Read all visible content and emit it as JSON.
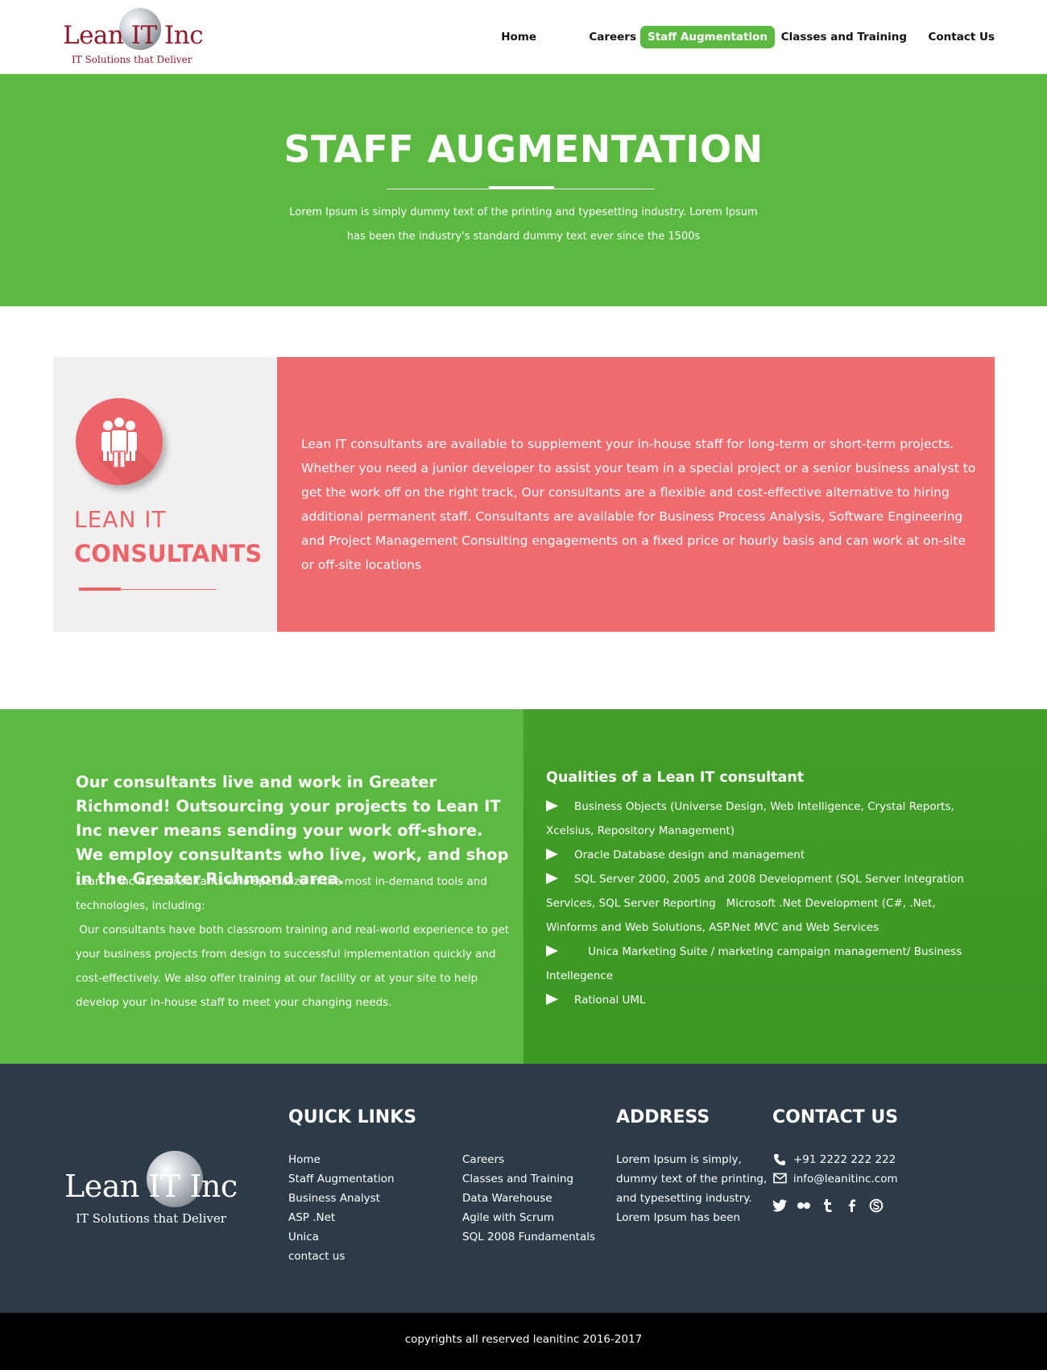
{
  "header": {
    "logo": {
      "brand": "Lean IT Inc",
      "tagline": "IT Solutions that Deliver"
    },
    "nav": [
      {
        "label": "Home",
        "active": false
      },
      {
        "label": "Careers",
        "active": false
      },
      {
        "label": "Staff Augmentation",
        "active": true
      },
      {
        "label": "Classes and Training",
        "active": false
      },
      {
        "label": "Contact Us",
        "active": false
      }
    ]
  },
  "hero": {
    "title": "STAFF AUGMENTATION",
    "subtitle": "Lorem Ipsum is simply dummy text of the printing and typesetting industry. Lorem Ipsum has been the industry's standard dummy text ever since the 1500s"
  },
  "consultants": {
    "icon": "team-icon",
    "heading_light": "LEAN IT",
    "heading_bold": "CONSULTANTS",
    "text": "Lean IT consultants are available to supplement your in-house staff for long-term or short-term projects. Whether you need a junior developer to assist your team in a special project or a senior business analyst to get the work off on the right track, Our consultants are a flexible and cost-effective alternative to hiring additional permanent staff. Consultants are available for Business Process Analysis, Software Engineering and Project Management Consulting engagements on a fixed price or hourly basis and can work at on-site or off-site locations"
  },
  "local": {
    "heading": "Our consultants live and work in Greater Richmond! Outsourcing your projects to Lean IT Inc never means sending your work off-shore. We employ consultants who live, work, and shop in the Greater Richmond area.",
    "body1": "Lean IT Inc has consultants who specialize in the most in-demand tools and technologies, including:",
    "body2": " Our consultants have both classroom training and real-world experience to get your business projects from design to successful implementation quickly and cost-effectively. We also offer training at our facility or at your site to help develop your in-house staff to meet your changing needs."
  },
  "qualities": {
    "title": "Qualities of a Lean IT consultant",
    "items": [
      "Business Objects (Universe Design, Web Intelligence, Crystal Reports, Xcelsius, Repository Management)",
      "Oracle Database design and management",
      "SQL Server 2000, 2005 and 2008 Development (SQL Server Integration Services, SQL Server Reporting   Microsoft .Net Development (C#, .Net, Winforms and Web Solutions, ASP.Net MVC and Web Services",
      "    Unica Marketing Suite / marketing campaign management/ Business Intellegence",
      "Rational UML"
    ]
  },
  "footer": {
    "logo": {
      "brand": "Lean IT Inc",
      "tagline": "IT Solutions that Deliver"
    },
    "quick_links_title": "QUICK LINKS",
    "links_col1": [
      "Home",
      "Staff Augmentation",
      "Business Analyst",
      "ASP .Net",
      "Unica",
      "contact us"
    ],
    "links_col2": [
      "Careers",
      "Classes and Training",
      "Data Warehouse",
      "Agile with Scrum",
      "SQL 2008 Fundamentals"
    ],
    "address_title": "ADDRESS",
    "address": "Lorem Ipsum is simply, dummy text of the printing, and typesetting industry. Lorem Ipsum has been",
    "contact_title": "CONTACT US",
    "phone": "+91 2222 222 222",
    "email": "info@leanitinc.com",
    "social": [
      "twitter-icon",
      "flickr-icon",
      "tumblr-icon",
      "facebook-icon",
      "skype-icon"
    ]
  },
  "copyright": "copyrights all reserved leanitinc 2016-2017"
}
